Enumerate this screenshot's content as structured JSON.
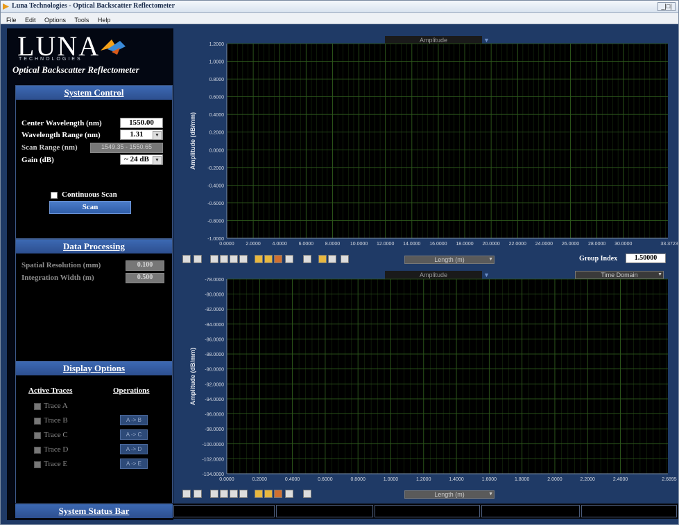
{
  "window": {
    "title": "Luna Technologies - Optical Backscatter Reflectometer",
    "controls": "_|□|"
  },
  "menu": [
    "File",
    "Edit",
    "Options",
    "Tools",
    "Help"
  ],
  "brand": {
    "logo_text": "LUNA",
    "logo_sub": "TECHNOLOGIES",
    "subtitle": "Optical Backscatter Reflectometer"
  },
  "system_control": {
    "title": "System Control",
    "center_wavelength_label": "Center Wavelength (nm)",
    "center_wavelength_value": "1550.00",
    "wavelength_range_label": "Wavelength Range (nm)",
    "wavelength_range_value": "1.31",
    "scan_range_label": "Scan Range (nm)",
    "scan_range_value": "1549.35 - 1550.65",
    "gain_label": "Gain (dB)",
    "gain_value": "~ 24 dB",
    "continuous_scan_label": "Continuous Scan",
    "scan_button": "Scan"
  },
  "data_processing": {
    "title": "Data Processing",
    "spatial_resolution_label": "Spatial Resolution (mm)",
    "spatial_resolution_value": "0.100",
    "integration_width_label": "Integration Width (m)",
    "integration_width_value": "0.500"
  },
  "display_options": {
    "title": "Display Options",
    "active_traces_label": "Active Traces",
    "operations_label": "Operations",
    "traces": [
      {
        "label": "Trace A",
        "op": ""
      },
      {
        "label": "Trace B",
        "op": "A -> B"
      },
      {
        "label": "Trace C",
        "op": "A -> C"
      },
      {
        "label": "Trace D",
        "op": "A -> D"
      },
      {
        "label": "Trace E",
        "op": "A -> E"
      }
    ]
  },
  "status_bar": {
    "label": "System Status Bar"
  },
  "chart_data": [
    {
      "type": "line",
      "title": "Amplitude",
      "ylabel": "Amplitude (dB/mm)",
      "xlabel": "Length (m)",
      "ylim": [
        -1.0,
        1.2
      ],
      "xlim": [
        0,
        33.3723
      ],
      "x_ticks": [
        "0.0000",
        "2.0000",
        "4.0000",
        "6.0000",
        "8.0000",
        "10.0000",
        "12.0000",
        "14.0000",
        "16.0000",
        "18.0000",
        "20.0000",
        "22.0000",
        "24.0000",
        "26.0000",
        "28.0000",
        "30.0000"
      ],
      "x_end_label": "33.3723",
      "y_ticks": [
        "1.2000",
        "1.0000",
        "0.8000",
        "0.6000",
        "0.4000",
        "0.2000",
        "0.0000",
        "-0.2000",
        "-0.4000",
        "-0.6000",
        "-0.8000",
        "-1.0000"
      ],
      "grid": true,
      "series": [],
      "group_index_label": "Group Index",
      "group_index_value": "1.50000"
    },
    {
      "type": "line",
      "title": "Amplitude",
      "ylabel": "Amplitude (dB/mm)",
      "xlabel": "Length (m)",
      "ylim": [
        -104.0,
        -78.0
      ],
      "xlim": [
        0,
        2.6895
      ],
      "x_ticks": [
        "0.0000",
        "0.2000",
        "0.4000",
        "0.6000",
        "0.8000",
        "1.0000",
        "1.2000",
        "1.4000",
        "1.6000",
        "1.8000",
        "2.0000",
        "2.2000",
        "2.4000"
      ],
      "x_end_label": "2.6895",
      "y_ticks": [
        "-78.0000",
        "-80.0000",
        "-82.0000",
        "-84.0000",
        "-86.0000",
        "-88.0000",
        "-90.0000",
        "-92.0000",
        "-94.0000",
        "-96.0000",
        "-98.0000",
        "-100.0000",
        "-102.0000",
        "-104.0000"
      ],
      "grid": true,
      "series": [],
      "domain_mode": "Time Domain"
    }
  ],
  "colors": {
    "panel_bg": "#1f3a66",
    "plot_bg": "#000000",
    "grid": "#2e5a1c",
    "header_blue": "#3c69b3"
  }
}
